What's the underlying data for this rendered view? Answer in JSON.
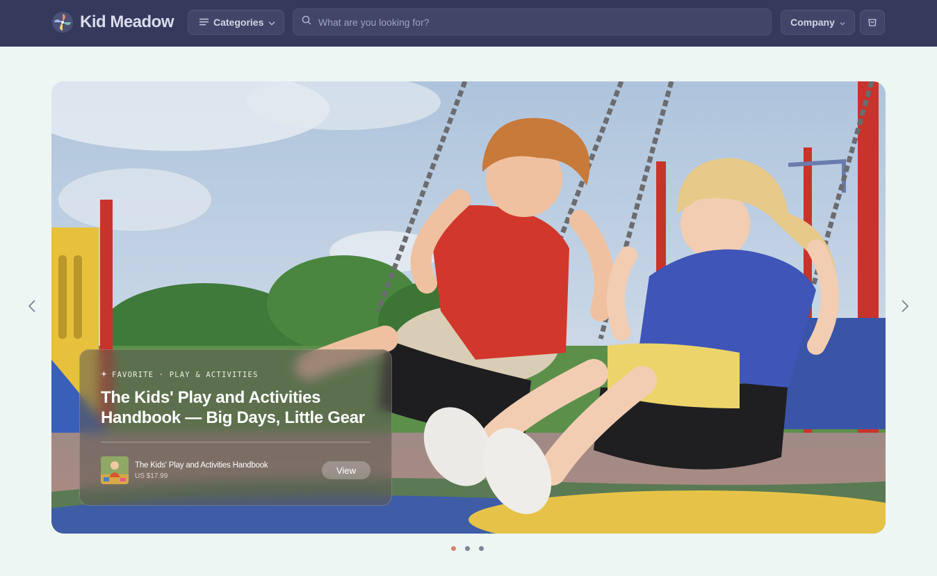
{
  "header": {
    "brand": "Kid Meadow",
    "categories_label": "Categories",
    "search_placeholder": "What are you looking for?",
    "company_label": "Company"
  },
  "hero": {
    "image_alt": "Two laughing children on playground swings",
    "eyebrow": "FAVORITE · PLAY & ACTIVITIES",
    "title": "The Kids' Play and Activities Handbook — Big Days, Little Gear",
    "product": {
      "name": "The Kids' Play and Activities Handbook",
      "price": "US $17.99",
      "cta": "View"
    }
  },
  "carousel": {
    "slides": 3,
    "active_index": 0
  },
  "colors": {
    "header_bg": "#353a5c",
    "page_bg": "#eef6f3",
    "dot_active": "#d98466",
    "dot_inactive": "#7f8597"
  },
  "icons": [
    "pinwheel-logo-icon",
    "menu-lines-icon",
    "chevron-down-icon",
    "search-icon",
    "shopping-bag-icon",
    "chevron-left-icon",
    "chevron-right-icon",
    "sparkle-icon"
  ]
}
